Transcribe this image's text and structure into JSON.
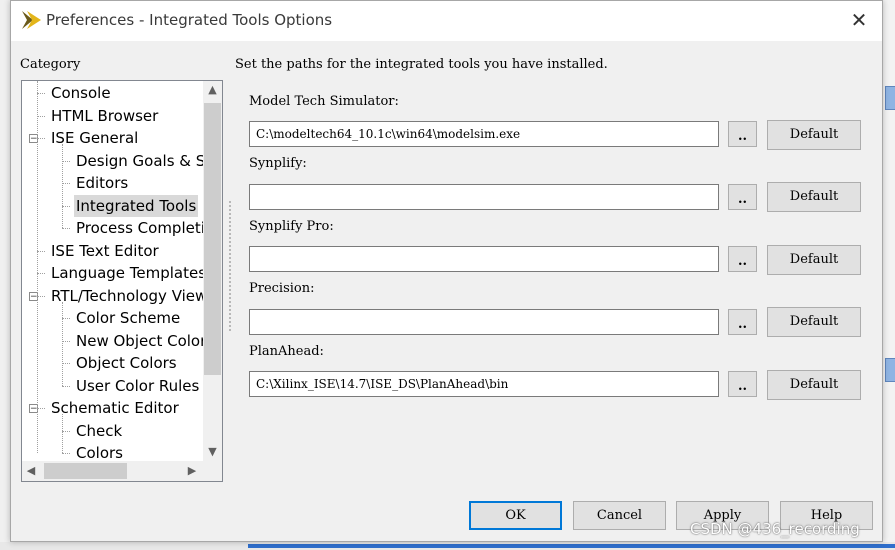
{
  "window": {
    "title": "Preferences - Integrated Tools Options",
    "close_glyph": "✕"
  },
  "category": {
    "label": "Category",
    "items": [
      {
        "label": "Console"
      },
      {
        "label": "HTML Browser"
      },
      {
        "label": "ISE General",
        "expander": "−"
      },
      {
        "label": "Design Goals & S"
      },
      {
        "label": "Editors"
      },
      {
        "label": "Integrated Tools",
        "selected": true
      },
      {
        "label": "Process Completi"
      },
      {
        "label": "ISE Text Editor"
      },
      {
        "label": "Language Templates"
      },
      {
        "label": "RTL/Technology View",
        "expander": "−"
      },
      {
        "label": "Color Scheme"
      },
      {
        "label": "New Object Color"
      },
      {
        "label": "Object Colors"
      },
      {
        "label": "User Color Rules"
      },
      {
        "label": "Schematic Editor",
        "expander": "−"
      },
      {
        "label": "Check"
      },
      {
        "label": "Colors"
      }
    ],
    "scroll_up": "▲",
    "scroll_down": "▼",
    "scroll_left": "◀",
    "scroll_right": "▶"
  },
  "main": {
    "intro": "Set the paths for the integrated tools you have installed.",
    "tools": [
      {
        "label": "Model Tech Simulator:",
        "value": "C:\\modeltech64_10.1c\\win64\\modelsim.exe",
        "browse": "..",
        "default": "Default"
      },
      {
        "label": "Synplify:",
        "value": "",
        "browse": "..",
        "default": "Default"
      },
      {
        "label": "Synplify Pro:",
        "value": "",
        "browse": "..",
        "default": "Default"
      },
      {
        "label": "Precision:",
        "value": "",
        "browse": "..",
        "default": "Default"
      },
      {
        "label": "PlanAhead:",
        "value": "C:\\Xilinx_ISE\\14.7\\ISE_DS\\PlanAhead\\bin",
        "browse": "..",
        "default": "Default"
      }
    ]
  },
  "buttons": {
    "ok": "OK",
    "cancel": "Cancel",
    "apply": "Apply",
    "help": "Help"
  },
  "watermark": "CSDN @436_recording",
  "colors": {
    "accent": "#0078d7",
    "selection": "#d9d9d9",
    "icon_yellow": "#e3b51a",
    "icon_dark": "#6b5a1a"
  }
}
